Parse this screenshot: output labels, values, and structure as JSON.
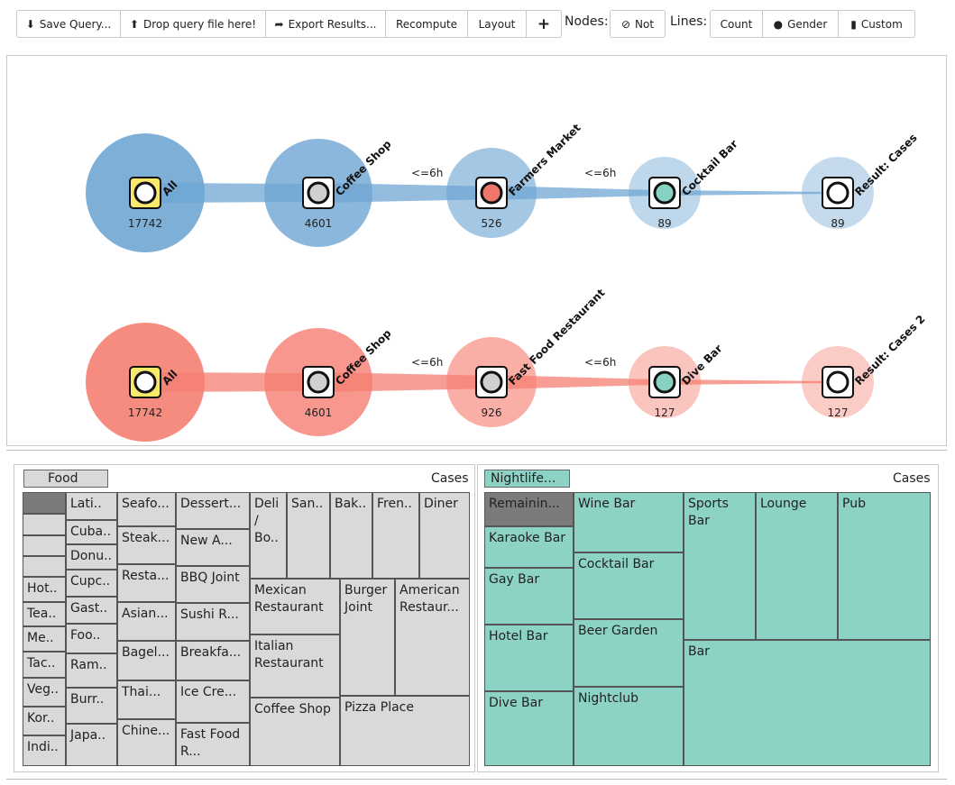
{
  "toolbar": {
    "save_query": "Save Query...",
    "drop_query": "Drop query file here!",
    "export_results": "Export Results...",
    "recompute": "Recompute",
    "layout": "Layout",
    "add": "+",
    "nodes_label": "Nodes:",
    "not": "Not",
    "lines_label": "Lines:",
    "count": "Count",
    "gender": "Gender",
    "custom": "Custom"
  },
  "flows": [
    {
      "color": "#6fa6d3",
      "nodes": [
        {
          "label": "All",
          "count": "17742",
          "box": "#f8e86b",
          "dot": "#ffffff"
        },
        {
          "label": "Coffee Shop",
          "count": "4601",
          "box": "#ffffff",
          "dot": "#d0d0d0"
        },
        {
          "label": "Farmers Market",
          "count": "526",
          "box": "#ffffff",
          "dot": "#f0756a"
        },
        {
          "label": "Cocktail Bar",
          "count": "89",
          "box": "#ffffff",
          "dot": "#86d2c3"
        },
        {
          "label": "Result: Cases",
          "count": "89",
          "box": "#ffffff",
          "dot": "#ffffff"
        }
      ],
      "gaps": [
        "<=6h",
        "<=6h"
      ]
    },
    {
      "color": "#f57f72",
      "nodes": [
        {
          "label": "All",
          "count": "17742",
          "box": "#f8e86b",
          "dot": "#ffffff"
        },
        {
          "label": "Coffee Shop",
          "count": "4601",
          "box": "#ffffff",
          "dot": "#d0d0d0"
        },
        {
          "label": "Fast Food Restaurant",
          "count": "926",
          "box": "#ffffff",
          "dot": "#d0d0d0"
        },
        {
          "label": "Dive Bar",
          "count": "127",
          "box": "#ffffff",
          "dot": "#86d2c3"
        },
        {
          "label": "Result: Cases 2",
          "count": "127",
          "box": "#ffffff",
          "dot": "#ffffff"
        }
      ],
      "gaps": [
        "<=6h",
        "<=6h"
      ]
    }
  ],
  "treemap_left": {
    "header": "Food",
    "cases": "Cases",
    "cells": [
      "",
      "",
      "",
      "",
      "Hot..",
      "Tea..",
      "Me..",
      "Tac..",
      "Veg..",
      "Kor..",
      "Indi..",
      "Lati..",
      "Cuba..",
      "Donu..",
      "Cupc..",
      "Gast..",
      "Foo..",
      "Ram..",
      "Burr..",
      "Japa..",
      "Seafo...",
      "Steak...",
      "Resta...",
      "Asian...",
      "Bagel...",
      "Thai...",
      "Chine...",
      "Dessert...",
      "New A...",
      "BBQ Joint",
      "Sushi R...",
      "Breakfa...",
      "Ice Cre...",
      "Fast Food R...",
      "Deli / Bo..",
      "San..",
      "Bak..",
      "Fren..",
      "Diner",
      "Mexican Restaurant",
      "Burger Joint",
      "American Restaur...",
      "Italian Restaurant",
      "Pizza Place",
      "Coffee Shop"
    ]
  },
  "treemap_right": {
    "header": "Nightlife...",
    "cases": "Cases",
    "cells": [
      "Remainin...",
      "Karaoke Bar",
      "Gay Bar",
      "Hotel Bar",
      "Dive Bar",
      "Wine Bar",
      "Cocktail Bar",
      "Beer Garden",
      "Nightclub",
      "Sports Bar",
      "Lounge",
      "Pub",
      "Bar"
    ]
  }
}
